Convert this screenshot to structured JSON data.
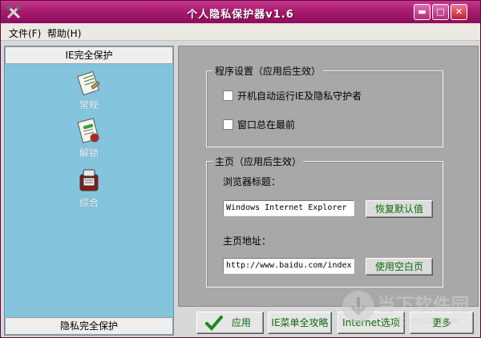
{
  "window": {
    "title": "个人隐私保护器v1.6",
    "controls": {
      "minimize": "▬",
      "maximize": "□",
      "close": "✕"
    }
  },
  "menu": {
    "file": "文件(F)",
    "help": "帮助(H)"
  },
  "sidebar": {
    "header": "IE完全保护",
    "footer": "隐私完全保护",
    "items": [
      {
        "label": "常规",
        "icon": "document-icon"
      },
      {
        "label": "解锁",
        "icon": "unlock-document-icon"
      },
      {
        "label": "综合",
        "icon": "tools-icon"
      }
    ]
  },
  "settings": {
    "program_group_title": "程序设置（应用后生效）",
    "autostart_label": "开机自动运行IE及隐私守护者",
    "autostart_checked": false,
    "topmost_label": "窗口总在最前",
    "topmost_checked": false,
    "homepage_group_title": "主页（应用后生效）",
    "browser_title_label": "浏览器标题：",
    "browser_title_value": "Windows Internet Explorer",
    "restore_default_label": "恢复默认值",
    "homepage_url_label": "主页地址：",
    "homepage_url_value": "http://www.baidu.com/index.",
    "use_blank_label": "使用空白页"
  },
  "buttons": {
    "apply": "应用",
    "ie_menu": "IE菜单全攻略",
    "internet_options": "Internet选项",
    "more": "更多"
  },
  "watermark": {
    "text": "当下软件园",
    "url": "downxia.com"
  },
  "colors": {
    "titlebar": "#a81c6f",
    "sidebar": "#85c4dd",
    "panel": "#a8a8a8",
    "button_text": "#0b6b0b"
  }
}
